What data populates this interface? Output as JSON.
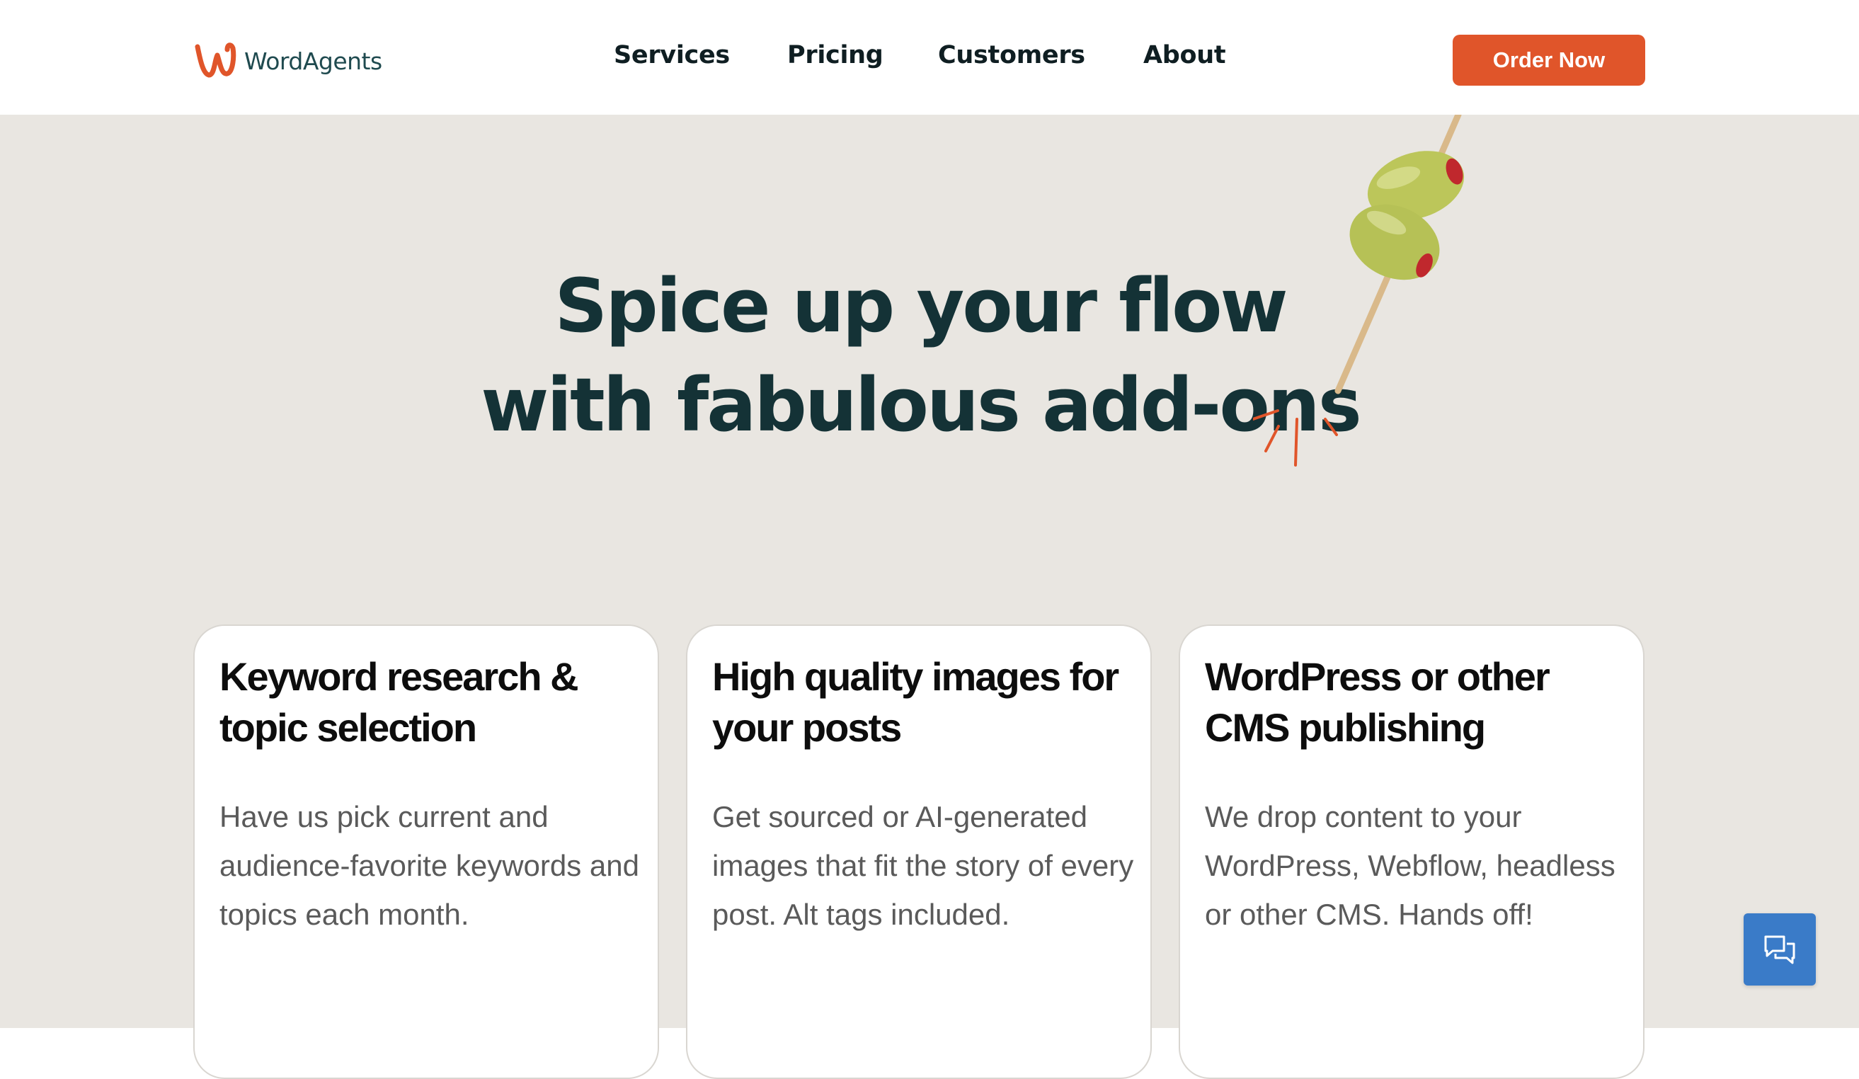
{
  "brand": {
    "name": "WordAgents",
    "accent_color": "#e0552a",
    "text_color": "#1f4a4f"
  },
  "nav": {
    "items": [
      "Services",
      "Pricing",
      "Customers",
      "About"
    ],
    "cta_label": "Order Now"
  },
  "hero": {
    "headline_line1": "Spice up your flow",
    "headline_line2": "with fabulous add-ons",
    "background_color": "#e9e6e1",
    "illustration": "olive-skewer-icon"
  },
  "cards": [
    {
      "title": "Keyword research & topic selection",
      "description": "Have us pick current and audience-favorite keywords and topics each month."
    },
    {
      "title": "High quality images for your posts",
      "description": "Get sourced or AI-generated images that fit the story of every post. Alt tags included."
    },
    {
      "title": "WordPress or other CMS publishing",
      "description": "We drop content to your WordPress, Webflow, headless or other CMS. Hands off!"
    }
  ],
  "chat": {
    "icon": "chat-bubbles-icon",
    "color": "#3a7bc8"
  }
}
